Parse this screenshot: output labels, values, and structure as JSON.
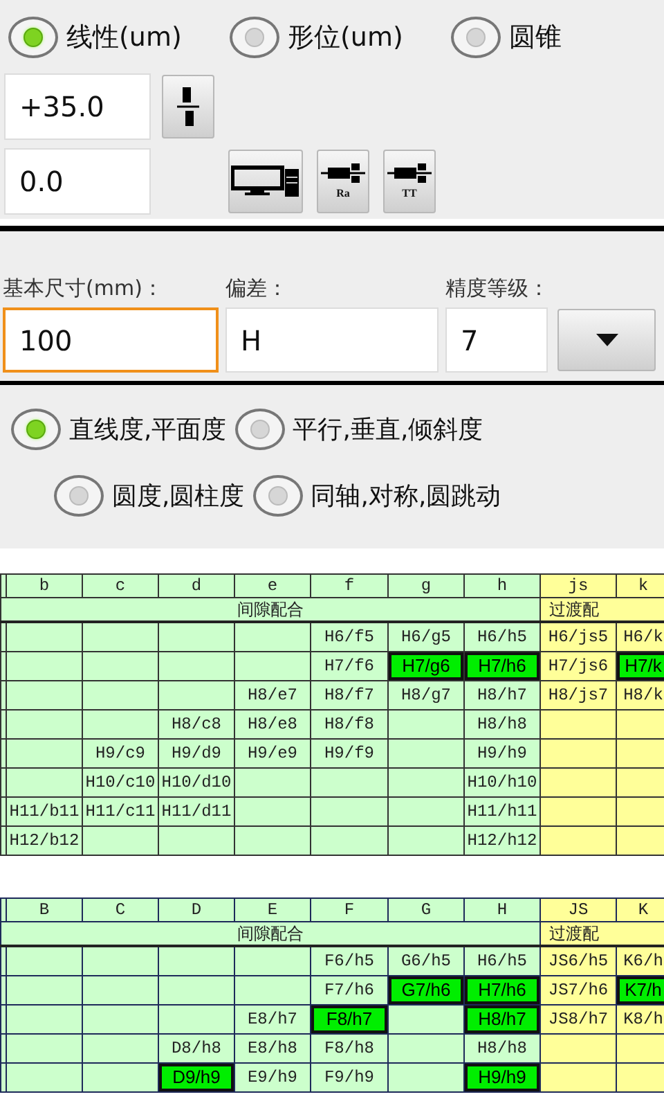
{
  "mode_options": [
    {
      "label": "线性(um)",
      "selected": true
    },
    {
      "label": "形位(um)",
      "selected": false
    },
    {
      "label": "圆锥",
      "selected": false
    }
  ],
  "offset_rows": [
    {
      "field": {
        "value": "+35.0"
      },
      "buttons": [
        {
          "kind": "flip"
        }
      ]
    },
    {
      "field": {
        "value": "0.0"
      },
      "buttons": [
        {
          "kind": "computer"
        },
        {
          "kind": "part",
          "label": "Ra"
        },
        {
          "kind": "part",
          "label": "TT"
        }
      ]
    }
  ],
  "fit_fields": [
    {
      "kind": "size",
      "label": "基本尺寸(mm)：",
      "value": "100",
      "focused": true
    },
    {
      "kind": "deviation",
      "label": "偏差：",
      "value": "H",
      "focused": false
    },
    {
      "kind": "grade",
      "label": "精度等级：",
      "value": "7",
      "focused": false
    }
  ],
  "tolerance_options": [
    [
      {
        "label": "直线度,平面度",
        "selected": true
      },
      {
        "label": "平行,垂直,倾斜度",
        "selected": false
      }
    ],
    [
      {
        "label": "圆度,圆柱度",
        "selected": false
      },
      {
        "label": "同轴,对称,圆跳动",
        "selected": false
      }
    ]
  ],
  "tables": [
    {
      "kind": "hole",
      "columns": [
        {
          "kind": "clearance"
        },
        {
          "label": "b",
          "kind": "clearance"
        },
        {
          "label": "c",
          "kind": "clearance"
        },
        {
          "label": "d",
          "kind": "clearance"
        },
        {
          "label": "e",
          "kind": "clearance"
        },
        {
          "label": "f",
          "kind": "clearance"
        },
        {
          "label": "g",
          "kind": "clearance"
        },
        {
          "label": "h",
          "kind": "clearance"
        },
        {
          "label": "js",
          "kind": "transition"
        },
        {
          "label": "k",
          "kind": "transition"
        }
      ],
      "groups": [
        {
          "kind": "clearance",
          "label": "间隙配合"
        },
        {
          "kind": "transition",
          "label": "过渡配"
        }
      ],
      "rows": [
        [
          null,
          null,
          null,
          null,
          null,
          {
            "text": "H6/f5",
            "highlighted": false
          },
          {
            "text": "H6/g5",
            "highlighted": false
          },
          {
            "text": "H6/h5",
            "highlighted": false
          },
          {
            "text": "H6/js5",
            "highlighted": false
          },
          {
            "text": "H6/k",
            "highlighted": false
          }
        ],
        [
          null,
          null,
          null,
          null,
          null,
          {
            "text": "H7/f6",
            "highlighted": false
          },
          {
            "text": "H7/g6",
            "highlighted": true
          },
          {
            "text": "H7/h6",
            "highlighted": true
          },
          {
            "text": "H7/js6",
            "highlighted": false
          },
          {
            "text": "H7/k",
            "highlighted": true
          }
        ],
        [
          null,
          null,
          null,
          null,
          {
            "text": "H8/e7",
            "highlighted": false
          },
          {
            "text": "H8/f7",
            "highlighted": false
          },
          {
            "text": "H8/g7",
            "highlighted": false
          },
          {
            "text": "H8/h7",
            "highlighted": false
          },
          {
            "text": "H8/js7",
            "highlighted": false
          },
          {
            "text": "H8/k",
            "highlighted": false
          }
        ],
        [
          null,
          null,
          null,
          {
            "text": "H8/c8",
            "highlighted": false
          },
          {
            "text": "H8/e8",
            "highlighted": false
          },
          {
            "text": "H8/f8",
            "highlighted": false
          },
          null,
          {
            "text": "H8/h8",
            "highlighted": false
          },
          null,
          null
        ],
        [
          null,
          null,
          {
            "text": "H9/c9",
            "highlighted": false
          },
          {
            "text": "H9/d9",
            "highlighted": false
          },
          {
            "text": "H9/e9",
            "highlighted": false
          },
          {
            "text": "H9/f9",
            "highlighted": false
          },
          null,
          {
            "text": "H9/h9",
            "highlighted": false
          },
          null,
          null
        ],
        [
          null,
          null,
          {
            "text": "H10/c10",
            "highlighted": false
          },
          {
            "text": "H10/d10",
            "highlighted": false
          },
          null,
          null,
          null,
          {
            "text": "H10/h10",
            "highlighted": false
          },
          null,
          null
        ],
        [
          null,
          {
            "text": "H11/b11",
            "highlighted": false
          },
          {
            "text": "H11/c11",
            "highlighted": false
          },
          {
            "text": "H11/d11",
            "highlighted": false
          },
          null,
          null,
          null,
          {
            "text": "H11/h11",
            "highlighted": false
          },
          null,
          null
        ],
        [
          null,
          {
            "text": "H12/b12",
            "highlighted": false
          },
          null,
          null,
          null,
          null,
          null,
          {
            "text": "H12/h12",
            "highlighted": false
          },
          null,
          null
        ]
      ]
    },
    {
      "kind": "shaft",
      "columns": [
        {
          "kind": "clearance"
        },
        {
          "label": "B",
          "kind": "clearance"
        },
        {
          "label": "C",
          "kind": "clearance"
        },
        {
          "label": "D",
          "kind": "clearance"
        },
        {
          "label": "E",
          "kind": "clearance"
        },
        {
          "label": "F",
          "kind": "clearance"
        },
        {
          "label": "G",
          "kind": "clearance"
        },
        {
          "label": "H",
          "kind": "clearance"
        },
        {
          "label": "JS",
          "kind": "transition"
        },
        {
          "label": "K",
          "kind": "transition"
        }
      ],
      "groups": [
        {
          "kind": "clearance",
          "label": "间隙配合"
        },
        {
          "kind": "transition",
          "label": "过渡配"
        }
      ],
      "rows": [
        [
          null,
          null,
          null,
          null,
          null,
          {
            "text": "F6/h5",
            "highlighted": false
          },
          {
            "text": "G6/h5",
            "highlighted": false
          },
          {
            "text": "H6/h5",
            "highlighted": false
          },
          {
            "text": "JS6/h5",
            "highlighted": false
          },
          {
            "text": "K6/h",
            "highlighted": false
          }
        ],
        [
          null,
          null,
          null,
          null,
          null,
          {
            "text": "F7/h6",
            "highlighted": false
          },
          {
            "text": "G7/h6",
            "highlighted": true
          },
          {
            "text": "H7/h6",
            "highlighted": true
          },
          {
            "text": "JS7/h6",
            "highlighted": false
          },
          {
            "text": "K7/h",
            "highlighted": true
          }
        ],
        [
          null,
          null,
          null,
          null,
          {
            "text": "E8/h7",
            "highlighted": false
          },
          {
            "text": "F8/h7",
            "highlighted": true
          },
          null,
          {
            "text": "H8/h7",
            "highlighted": true
          },
          {
            "text": "JS8/h7",
            "highlighted": false
          },
          {
            "text": "K8/h",
            "highlighted": false
          }
        ],
        [
          null,
          null,
          null,
          {
            "text": "D8/h8",
            "highlighted": false
          },
          {
            "text": "E8/h8",
            "highlighted": false
          },
          {
            "text": "F8/h8",
            "highlighted": false
          },
          null,
          {
            "text": "H8/h8",
            "highlighted": false
          },
          null,
          null
        ],
        [
          null,
          null,
          null,
          {
            "text": "D9/h9",
            "highlighted": true
          },
          {
            "text": "E9/h9",
            "highlighted": false
          },
          {
            "text": "F9/h9",
            "highlighted": false
          },
          null,
          {
            "text": "H9/h9",
            "highlighted": true
          },
          null,
          null
        ]
      ]
    }
  ]
}
